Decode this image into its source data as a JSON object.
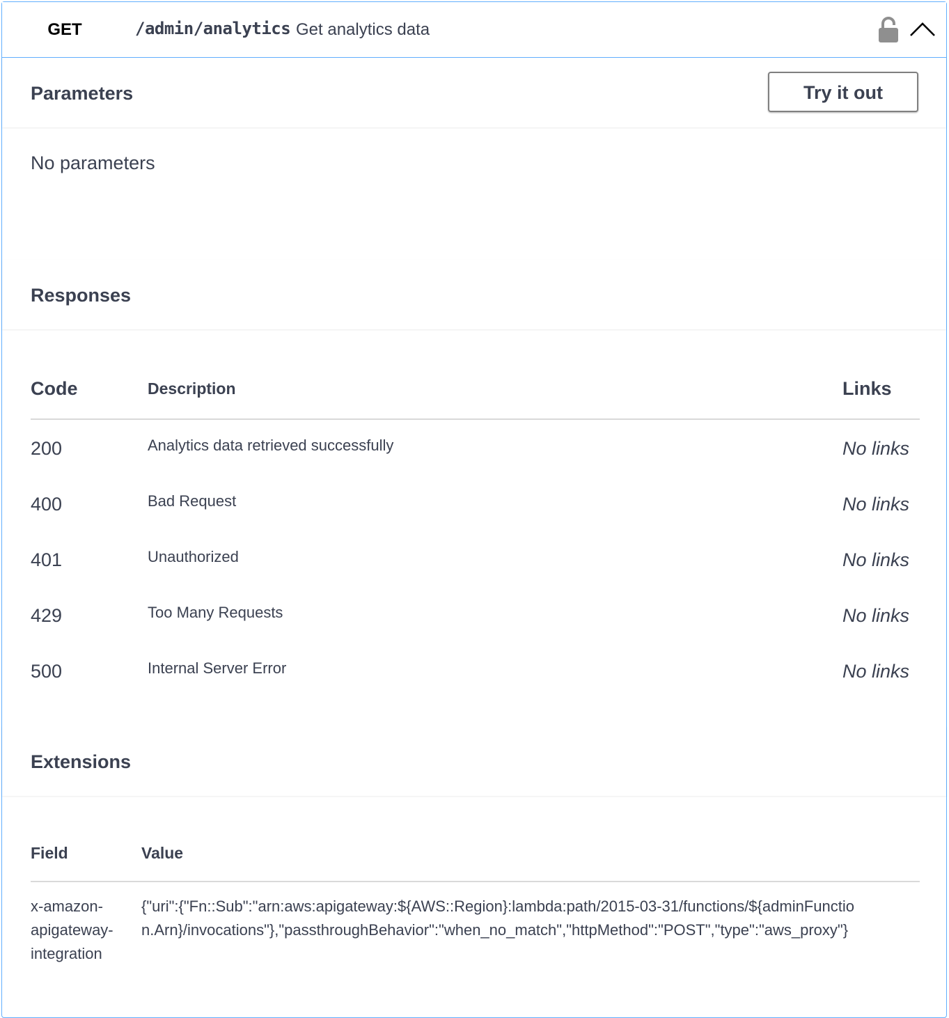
{
  "summary": {
    "method": "GET",
    "path": "/admin/analytics",
    "description": "Get analytics data",
    "lock_icon": "lock-icon",
    "collapse_icon": "chevron-up-icon",
    "method_color": "#61affe"
  },
  "parameters": {
    "title": "Parameters",
    "try_label": "Try it out",
    "empty_text": "No parameters"
  },
  "responses": {
    "title": "Responses",
    "headers": {
      "code": "Code",
      "description": "Description",
      "links": "Links"
    },
    "rows": [
      {
        "code": "200",
        "description": "Analytics data retrieved successfully",
        "links": "No links"
      },
      {
        "code": "400",
        "description": "Bad Request",
        "links": "No links"
      },
      {
        "code": "401",
        "description": "Unauthorized",
        "links": "No links"
      },
      {
        "code": "429",
        "description": "Too Many Requests",
        "links": "No links"
      },
      {
        "code": "500",
        "description": "Internal Server Error",
        "links": "No links"
      }
    ]
  },
  "extensions": {
    "title": "Extensions",
    "headers": {
      "field": "Field",
      "value": "Value"
    },
    "rows": [
      {
        "field": "x-amazon-apigateway-integration",
        "value": "{\"uri\":{\"Fn::Sub\":\"arn:aws:apigateway:${AWS::Region}:lambda:path/2015-03-31/functions/${adminFunction.Arn}/invocations\"},\"passthroughBehavior\":\"when_no_match\",\"httpMethod\":\"POST\",\"type\":\"aws_proxy\"}"
      }
    ]
  }
}
